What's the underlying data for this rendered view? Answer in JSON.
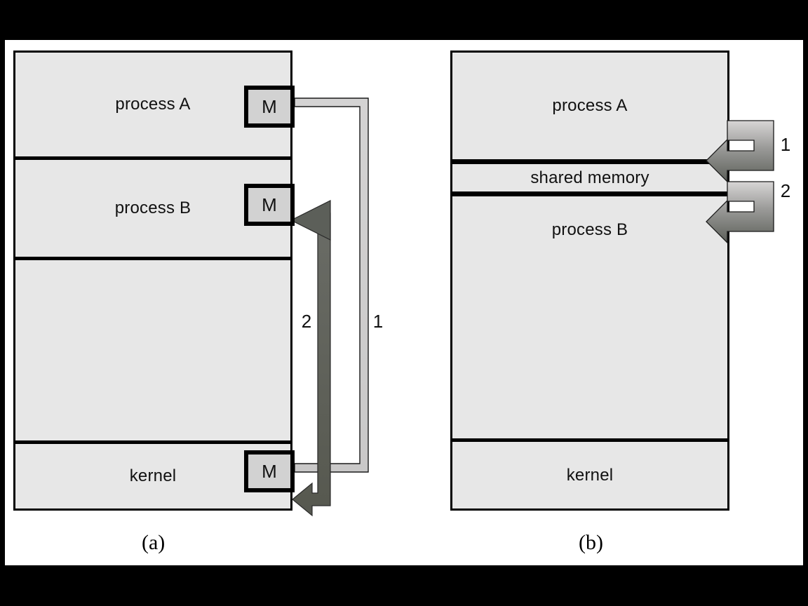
{
  "figure": {
    "type": "diagram",
    "topic": "Interprocess communication models: message passing versus shared memory",
    "background_color": "#000000",
    "page_color": "#ffffff",
    "box_fill": "#e7e7e7",
    "mbox_fill": "#d2d2d2",
    "arrow_light_color": "#d0d0d0",
    "arrow_dark_color": "#5c5f59",
    "outline_color": "#000000"
  },
  "panel_a": {
    "caption": "(a)",
    "segments": [
      {
        "label": "process A",
        "mbox": "M"
      },
      {
        "label": "process B",
        "mbox": "M"
      },
      {
        "label": "",
        "mbox": ""
      },
      {
        "label": "kernel",
        "mbox": "M"
      }
    ],
    "arrows": [
      {
        "id": "1",
        "label": "1",
        "from": "process A M",
        "to": "kernel M",
        "style": "light"
      },
      {
        "id": "2",
        "label": "2",
        "from": "kernel M",
        "to": "process B M",
        "style": "dark"
      }
    ]
  },
  "panel_b": {
    "caption": "(b)",
    "segments": [
      {
        "label": "process A"
      },
      {
        "label": "shared memory"
      },
      {
        "label": "process B"
      },
      {
        "label": ""
      },
      {
        "label": "kernel"
      }
    ],
    "arrows": [
      {
        "id": "1",
        "label": "1",
        "target": "shared memory",
        "style": "gradient-hook"
      },
      {
        "id": "2",
        "label": "2",
        "target": "process B",
        "style": "gradient-hook"
      }
    ]
  }
}
